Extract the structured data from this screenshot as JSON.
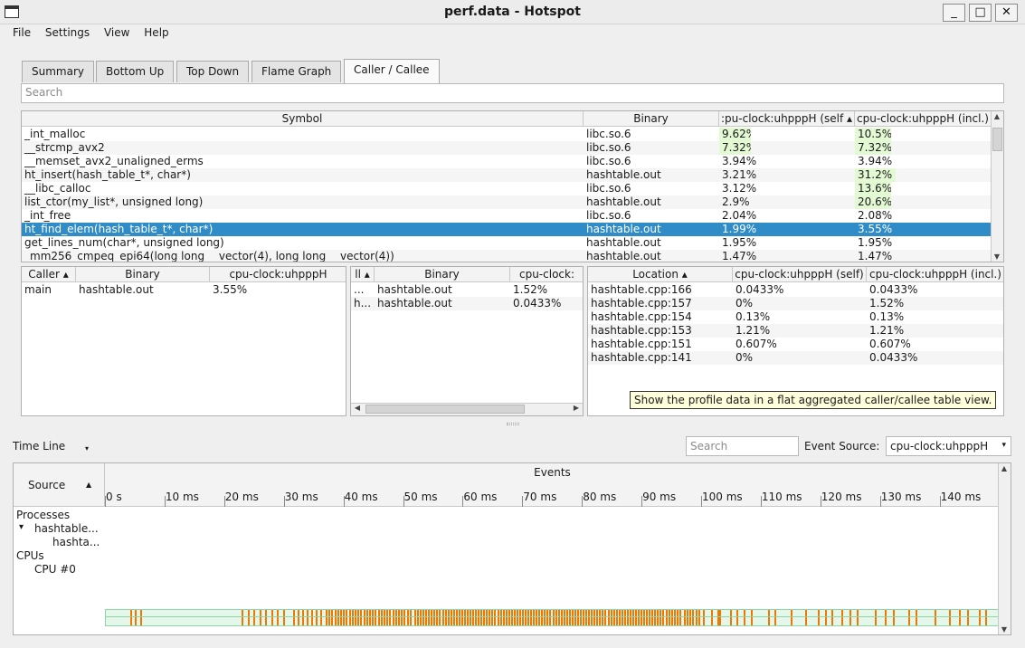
{
  "window": {
    "title": "perf.data - Hotspot",
    "minimize": "_",
    "maximize": "□",
    "close": "✕"
  },
  "menu": [
    "File",
    "Settings",
    "View",
    "Help"
  ],
  "tabs": [
    "Summary",
    "Bottom Up",
    "Top Down",
    "Flame Graph",
    "Caller / Callee"
  ],
  "active_tab": "Caller / Callee",
  "search_placeholder": "Search",
  "symbols": {
    "headers": [
      "Symbol",
      "Binary",
      ":pu-clock:uhpppH (self ▴",
      "cpu-clock:uhpppH (incl.)"
    ],
    "rows": [
      [
        "_int_malloc",
        "libc.so.6",
        "9.62%",
        "10.5%"
      ],
      [
        "__strcmp_avx2",
        "libc.so.6",
        "7.32%",
        "7.32%"
      ],
      [
        "__memset_avx2_unaligned_erms",
        "libc.so.6",
        "3.94%",
        "3.94%"
      ],
      [
        "ht_insert(hash_table_t*, char*)",
        "hashtable.out",
        "3.21%",
        "31.2%"
      ],
      [
        "__libc_calloc",
        "libc.so.6",
        "3.12%",
        "13.6%"
      ],
      [
        "list_ctor(my_list*, unsigned long)",
        "hashtable.out",
        "2.9%",
        "20.6%"
      ],
      [
        "_int_free",
        "libc.so.6",
        "2.04%",
        "2.08%"
      ],
      [
        "ht_find_elem(hash_table_t*, char*)",
        "hashtable.out",
        "1.99%",
        "3.55%"
      ],
      [
        "get_lines_num(char*, unsigned long)",
        "hashtable.out",
        "1.95%",
        "1.95%"
      ],
      [
        "_mm256_cmpeq_epi64(long long __vector(4), long long __vector(4))",
        "hashtable.out",
        "1.47%",
        "1.47%"
      ]
    ],
    "selected_row": 7
  },
  "callers": {
    "headers": [
      "Caller ▴",
      "Binary",
      "cpu-clock:uhpppH"
    ],
    "rows": [
      [
        "main",
        "hashtable.out",
        "3.55%"
      ]
    ]
  },
  "callees": {
    "headers": [
      "ll ▴",
      "Binary",
      "cpu-clock:"
    ],
    "rows": [
      [
        "...",
        "hashtable.out",
        "1.52%"
      ],
      [
        "h...",
        "hashtable.out",
        "0.0433%"
      ]
    ]
  },
  "locations": {
    "headers": [
      "Location ▴",
      "cpu-clock:uhpppH (self)",
      "cpu-clock:uhpppH (incl.)"
    ],
    "rows": [
      [
        "hashtable.cpp:166",
        "0.0433%",
        "0.0433%"
      ],
      [
        "hashtable.cpp:157",
        "0%",
        "1.52%"
      ],
      [
        "hashtable.cpp:154",
        "0.13%",
        "0.13%"
      ],
      [
        "hashtable.cpp:153",
        "1.21%",
        "1.21%"
      ],
      [
        "hashtable.cpp:151",
        "0.607%",
        "0.607%"
      ],
      [
        "hashtable.cpp:141",
        "0%",
        "0.0433%"
      ]
    ]
  },
  "tooltip": "Show the profile data in a flat aggregated caller/callee table view.",
  "timeline": {
    "label": "Time Line",
    "search_placeholder": "Search",
    "event_source_label": "Event Source:",
    "event_source_value": "cpu-clock:uhpppH",
    "source_header": "Source",
    "events_header": "Events",
    "ticks": [
      "0 s",
      "10 ms",
      "20 ms",
      "30 ms",
      "40 ms",
      "50 ms",
      "60 ms",
      "70 ms",
      "80 ms",
      "90 ms",
      "100 ms",
      "110 ms",
      "120 ms",
      "130 ms",
      "140 ms"
    ],
    "tree": [
      {
        "label": "Processes",
        "level": 0
      },
      {
        "label": "hashtable...",
        "level": 1
      },
      {
        "label": "hashta...",
        "level": 2
      },
      {
        "label": "CPUs",
        "level": 0
      },
      {
        "label": "CPU #0",
        "level": 1
      }
    ]
  },
  "colors": {
    "selection": "#308cc6",
    "event": "#f07800",
    "track": "#e5f7ea",
    "highlight": "#e3f9d4",
    "tooltip": "#ffffdc"
  }
}
